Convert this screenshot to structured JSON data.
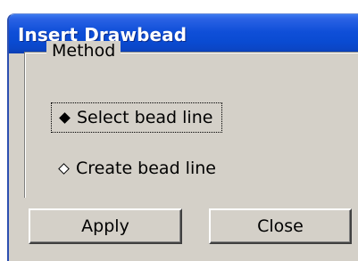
{
  "window": {
    "title": "Insert Drawbead"
  },
  "method_group": {
    "legend": "Method",
    "options": [
      {
        "label": "Select bead line",
        "selected": true
      },
      {
        "label": "Create bead line",
        "selected": false
      }
    ]
  },
  "buttons": {
    "apply_label": "Apply",
    "close_label": "Close"
  },
  "colors": {
    "titlebar": "#0a4bd2",
    "dialog_face": "#d4d0c8",
    "title_text": "#ffffff"
  }
}
